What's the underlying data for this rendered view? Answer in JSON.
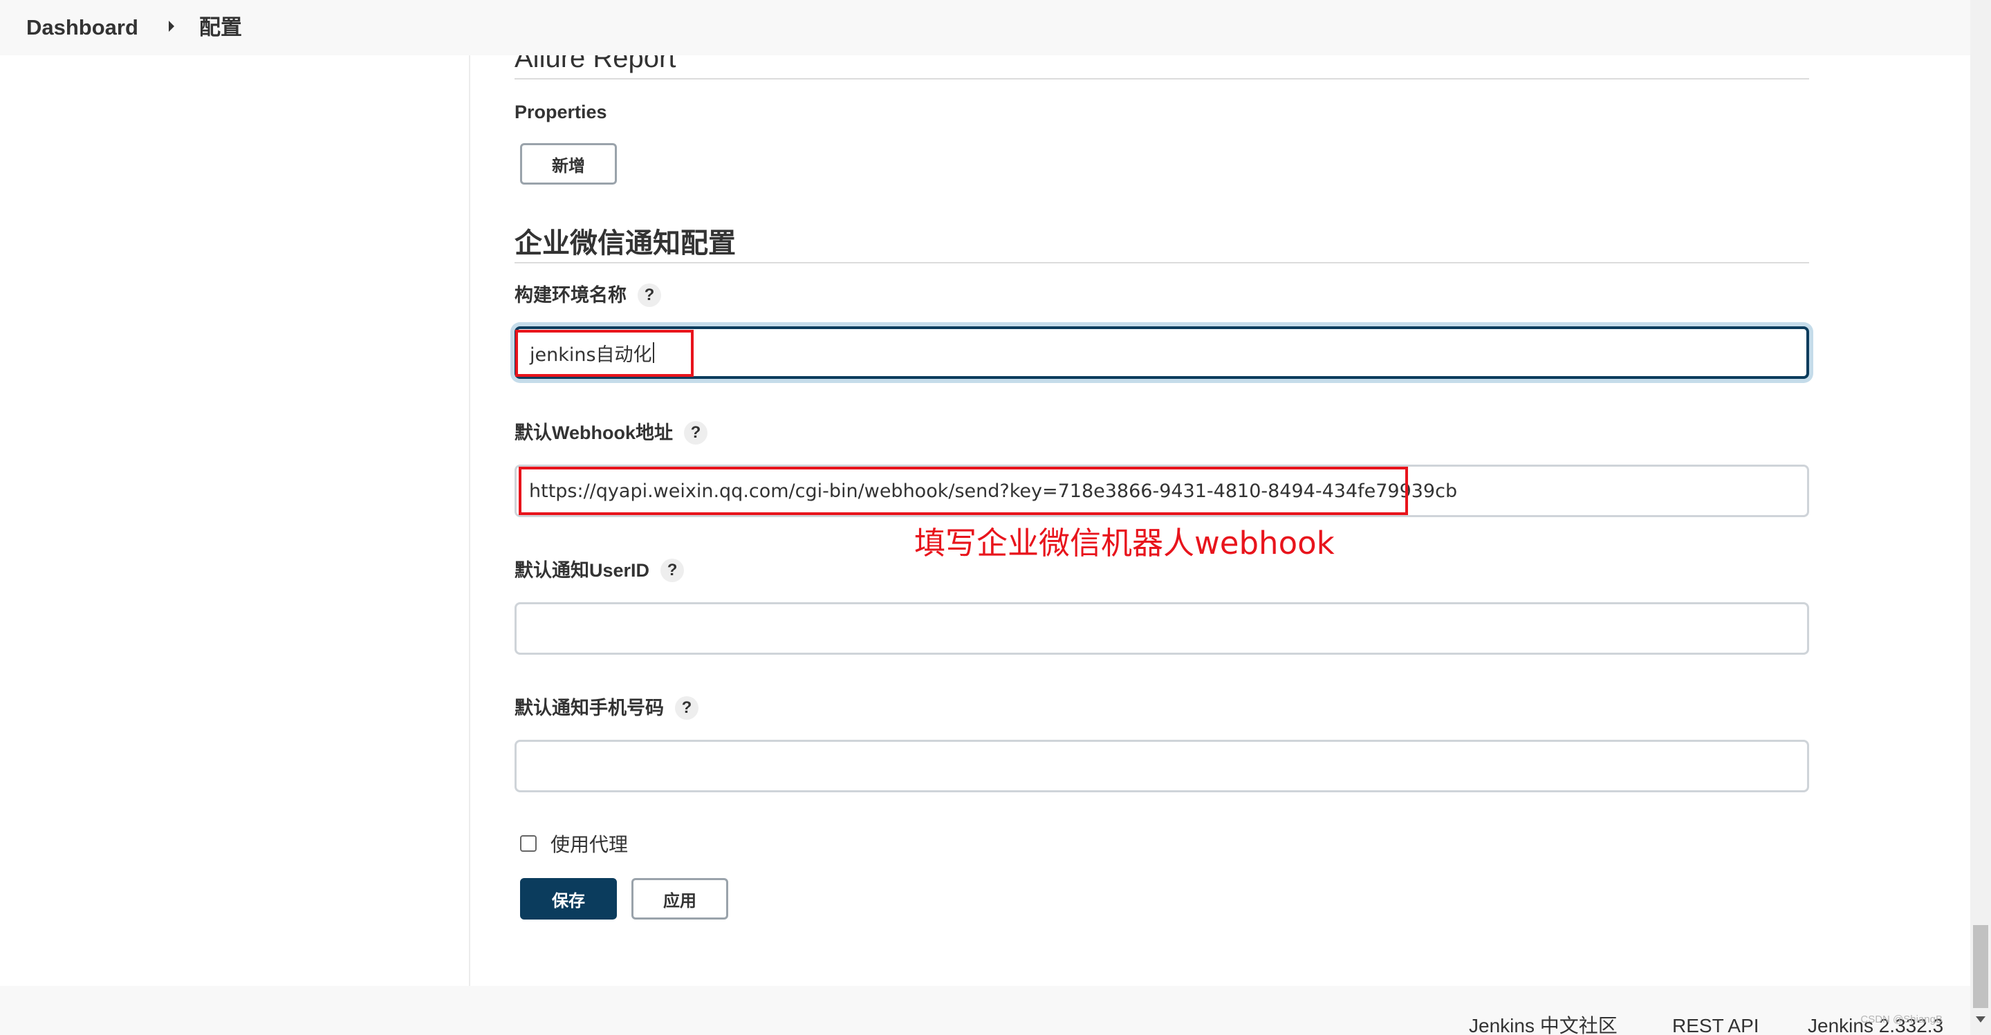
{
  "breadcrumb": {
    "dashboard": "Dashboard",
    "current": "配置"
  },
  "allure": {
    "title": "Allure Report",
    "properties_label": "Properties",
    "add_button": "新增"
  },
  "wechat": {
    "section_title": "企业微信通知配置",
    "env_name_label": "构建环境名称",
    "env_name_value": "jenkins自动化",
    "webhook_label": "默认Webhook地址",
    "webhook_value": "https://qyapi.weixin.qq.com/cgi-bin/webhook/send?key=718e3866-9431-4810-8494-434fe79939cb",
    "annotation": "填写企业微信机器人webhook",
    "userid_label": "默认通知UserID",
    "userid_value": "",
    "phone_label": "默认通知手机号码",
    "phone_value": "",
    "proxy_label": "使用代理",
    "proxy_checked": false
  },
  "help_glyph": "?",
  "actions": {
    "save": "保存",
    "apply": "应用"
  },
  "footer": {
    "community": "Jenkins 中文社区",
    "rest_api": "REST API",
    "version": "Jenkins 2.332.3",
    "watermark": "CSDN @ShiangB"
  },
  "colors": {
    "primary": "#0b3c5d",
    "annotation_red": "#e8141c",
    "focus_ring": "#c5dcea"
  },
  "icons": {
    "breadcrumb_separator": "chevron-right-icon",
    "help": "question-mark-icon"
  }
}
